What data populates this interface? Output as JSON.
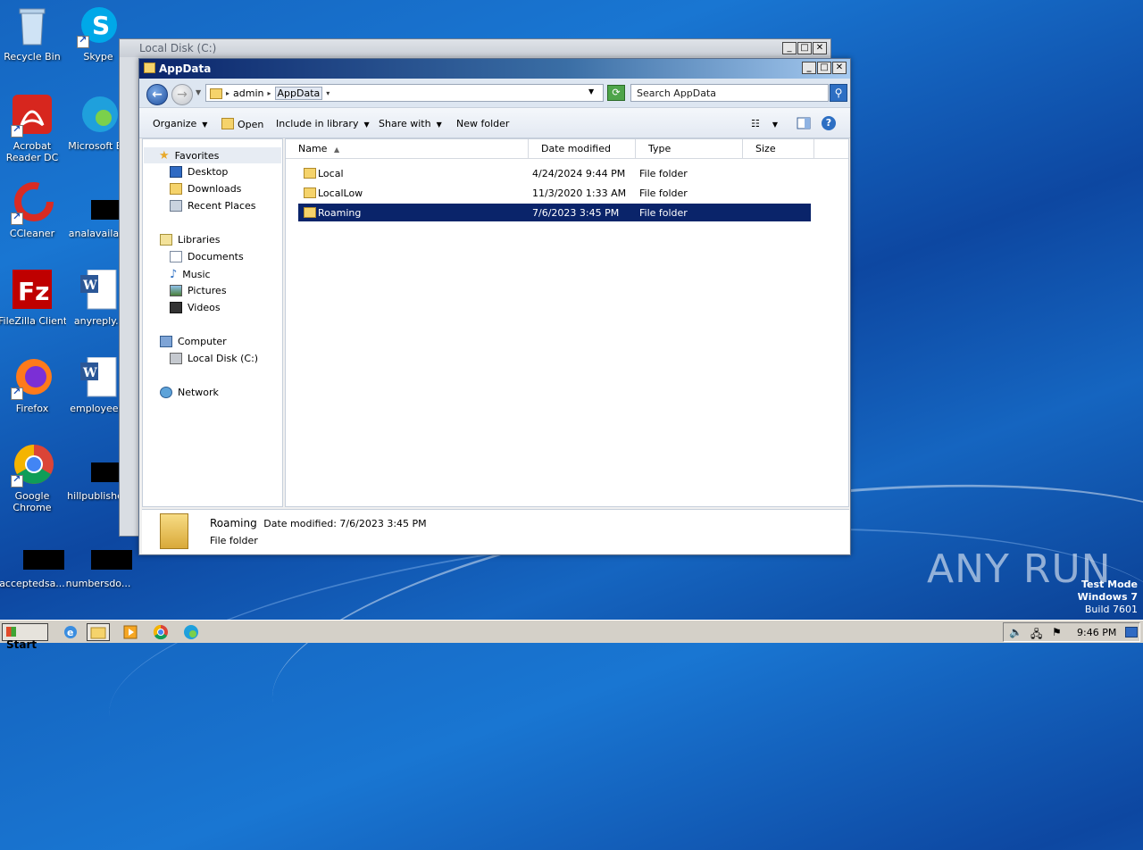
{
  "desktop": {
    "icons": [
      {
        "label": "Recycle Bin"
      },
      {
        "label": "Skype"
      },
      {
        "label": "Acrobat Reader DC"
      },
      {
        "label": "Microsoft Ed"
      },
      {
        "label": "CCleaner"
      },
      {
        "label": "analavailabl"
      },
      {
        "label": "FileZilla Client"
      },
      {
        "label": "anyreply.r"
      },
      {
        "label": "Firefox"
      },
      {
        "label": "employees."
      },
      {
        "label": "Google Chrome"
      },
      {
        "label": "hillpublished"
      },
      {
        "label": "acceptedsa..."
      },
      {
        "label": "numbersdo..."
      }
    ],
    "watermark": {
      "line1": "Test Mode",
      "line2": "Windows 7",
      "line3": "Build 7601"
    },
    "brand": "ANY RUN"
  },
  "back_window": {
    "title": "Local Disk (C:)"
  },
  "window": {
    "title": "AppData",
    "controls": {
      "minimize": "_",
      "maximize": "□",
      "close": "✕"
    },
    "address": {
      "crumbs": [
        "admin",
        "AppData"
      ]
    },
    "search": {
      "placeholder": "Search AppData"
    },
    "toolbar": {
      "organize": "Organize",
      "open": "Open",
      "include_in_library": "Include in library",
      "share_with": "Share with",
      "new_folder": "New folder"
    },
    "nav": {
      "favorites": "Favorites",
      "desktop": "Desktop",
      "downloads": "Downloads",
      "recent_places": "Recent Places",
      "libraries": "Libraries",
      "documents": "Documents",
      "music": "Music",
      "pictures": "Pictures",
      "videos": "Videos",
      "computer": "Computer",
      "local_disk": "Local Disk (C:)",
      "network": "Network"
    },
    "columns": {
      "name": "Name",
      "date_modified": "Date modified",
      "type": "Type",
      "size": "Size"
    },
    "files": [
      {
        "name": "Local",
        "date": "4/24/2024 9:44 PM",
        "type": "File folder",
        "size": ""
      },
      {
        "name": "LocalLow",
        "date": "11/3/2020 1:33 AM",
        "type": "File folder",
        "size": ""
      },
      {
        "name": "Roaming",
        "date": "7/6/2023 3:45 PM",
        "type": "File folder",
        "size": ""
      }
    ],
    "details": {
      "name": "Roaming",
      "date_label": "Date modified:",
      "date_value": "7/6/2023 3:45 PM",
      "type": "File folder"
    }
  },
  "taskbar": {
    "start": "Start",
    "clock": "9:46 PM"
  }
}
